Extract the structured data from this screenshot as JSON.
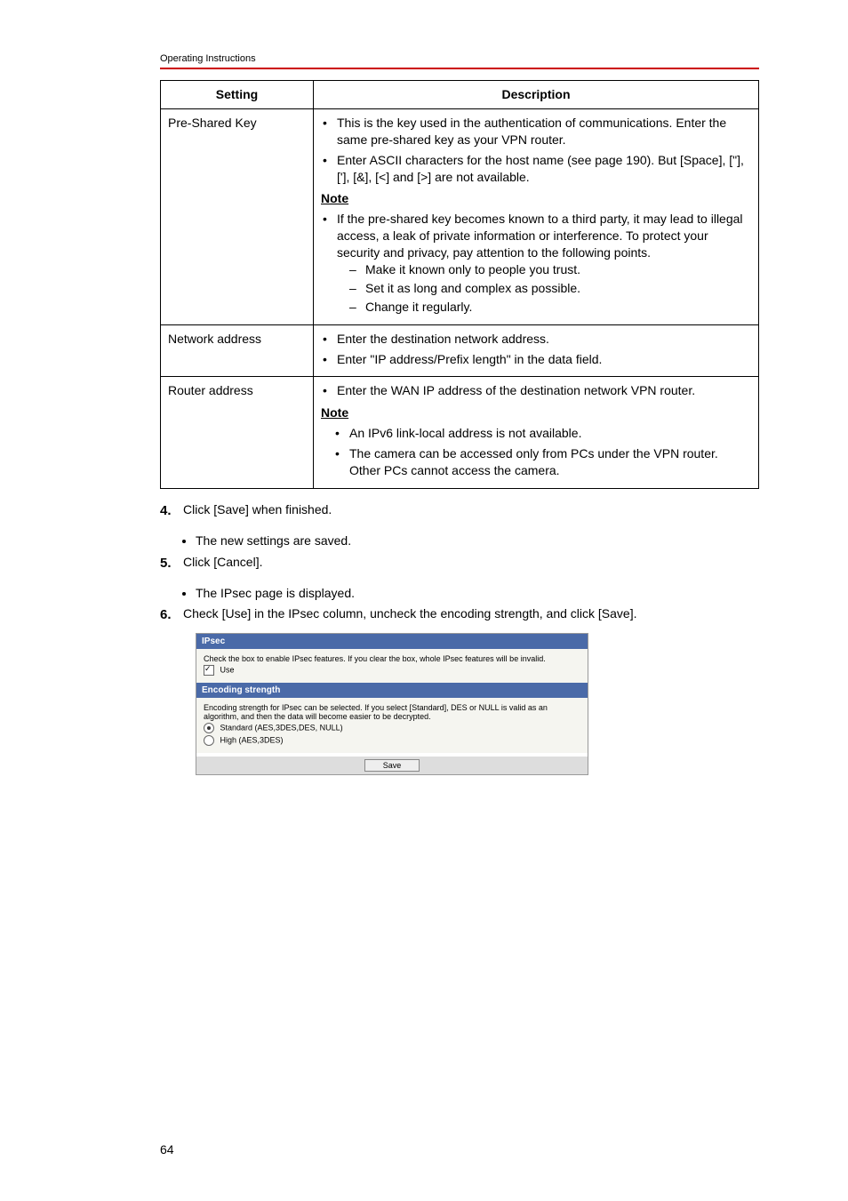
{
  "header": {
    "label": "Operating Instructions"
  },
  "table": {
    "columns": {
      "setting": "Setting",
      "description": "Description"
    },
    "rows": [
      {
        "setting": "Pre-Shared Key",
        "bullets": [
          "This is the key used in the authentication of communications. Enter the same pre-shared key as your VPN router.",
          "Enter ASCII characters for the host name (see page 190). But [Space], [\"], ['], [&], [<] and [>] are not available."
        ],
        "note_label": "Note",
        "note_bullets": [
          "If the pre-shared key becomes known to a third party, it may lead to illegal access, a leak of private information or interference. To protect your security and privacy, pay attention to the following points."
        ],
        "note_dashes": [
          "Make it known only to people you trust.",
          "Set it as long and complex as possible.",
          "Change it regularly."
        ]
      },
      {
        "setting": "Network address",
        "bullets": [
          "Enter the destination network address.",
          "Enter \"IP address/Prefix length\" in the data field."
        ]
      },
      {
        "setting": "Router address",
        "bullets": [
          "Enter the WAN IP address of the destination network VPN router."
        ],
        "note_label": "Note",
        "indent_bullets": [
          "An IPv6 link-local address is not available.",
          "The camera can be accessed only from PCs under the VPN router. Other PCs cannot access the camera."
        ]
      }
    ]
  },
  "steps": [
    {
      "num": "4.",
      "text": "Click [Save] when finished.",
      "sub": [
        "The new settings are saved."
      ]
    },
    {
      "num": "5.",
      "text": "Click [Cancel].",
      "sub": [
        "The IPsec page is displayed."
      ]
    },
    {
      "num": "6.",
      "text": "Check [Use] in the IPsec column, uncheck the encoding strength, and click [Save]."
    }
  ],
  "screenshot": {
    "ipsec_header": "IPsec",
    "ipsec_instr": "Check the box to enable IPsec features. If you clear the box, whole IPsec features will be invalid.",
    "use_label": "Use",
    "enc_header": "Encoding strength",
    "enc_instr": "Encoding strength for IPsec can be selected. If you select [Standard], DES or NULL is valid as an algorithm, and then the data will become easier to be decrypted.",
    "opt_standard": "Standard (AES,3DES,DES, NULL)",
    "opt_high": "High (AES,3DES)",
    "save_label": "Save"
  },
  "page_number": "64"
}
